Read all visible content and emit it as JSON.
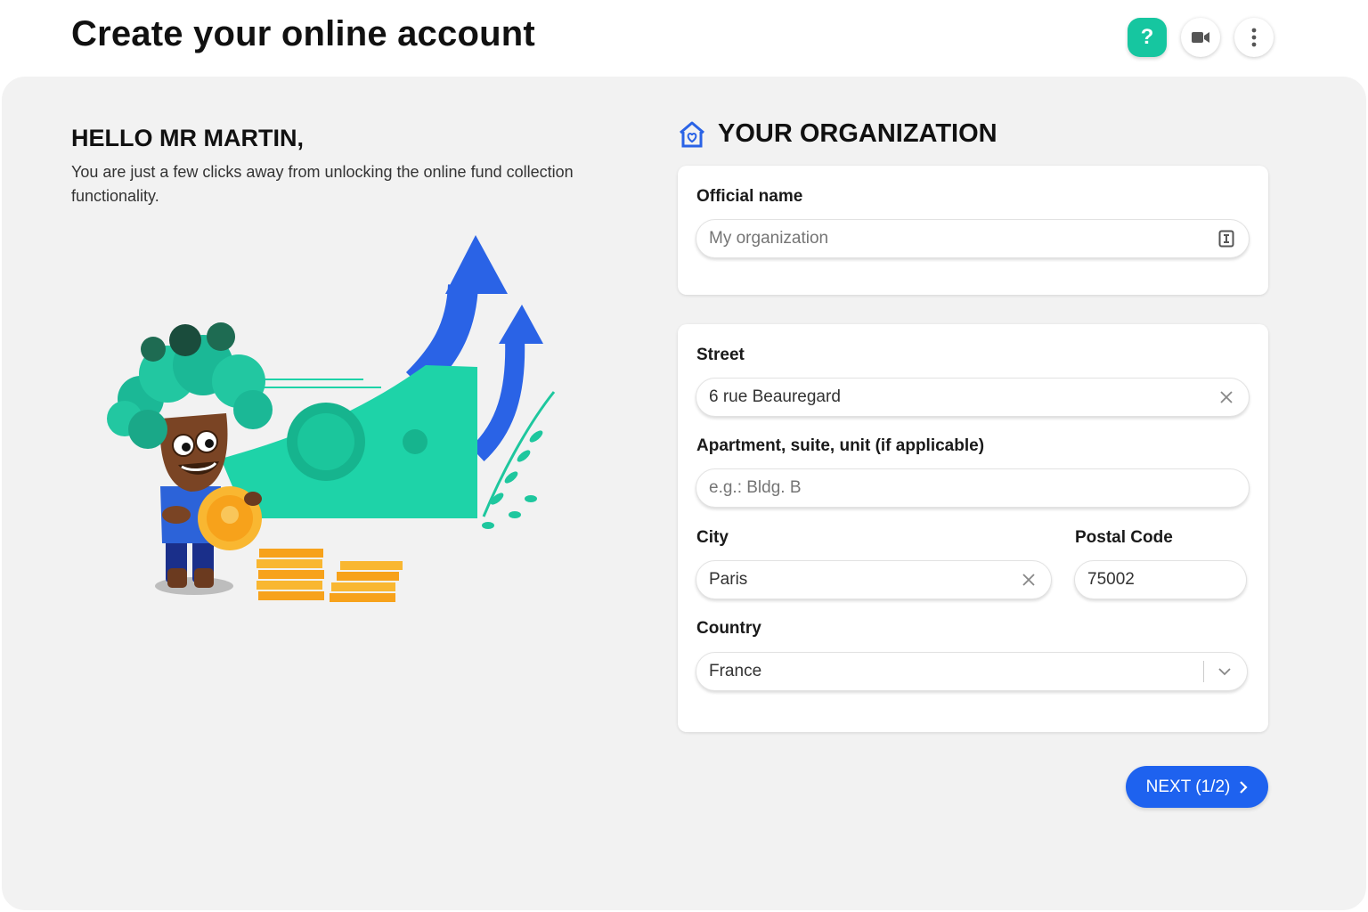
{
  "header": {
    "title": "Create your online account",
    "actions": [
      {
        "name": "help-button",
        "icon": "question-icon",
        "label": "?"
      },
      {
        "name": "video-button",
        "icon": "video-camera-icon"
      },
      {
        "name": "more-button",
        "icon": "more-vertical-icon"
      }
    ]
  },
  "welcome": {
    "greeting": "HELLO MR MARTIN,",
    "message": "You are just a few clicks away from unlocking the online fund collection functionality."
  },
  "organization": {
    "section_title": "YOUR ORGANIZATION",
    "section_icon": "house-heart-icon",
    "official_name": {
      "label": "Official name",
      "placeholder": "My organization",
      "value": ""
    },
    "street": {
      "label": "Street",
      "value": "6 rue Beauregard"
    },
    "apartment": {
      "label": "Apartment, suite, unit (if applicable)",
      "placeholder": "e.g.: Bldg. B",
      "value": ""
    },
    "city": {
      "label": "City",
      "value": "Paris"
    },
    "postal_code": {
      "label": "Postal Code",
      "value": "75002"
    },
    "country": {
      "label": "Country",
      "value": "France"
    }
  },
  "footer": {
    "next_label": "NEXT (1/2)"
  },
  "colors": {
    "accent_teal": "#16c6a0",
    "primary_blue": "#1e62ef",
    "background": "#f2f2f2"
  }
}
